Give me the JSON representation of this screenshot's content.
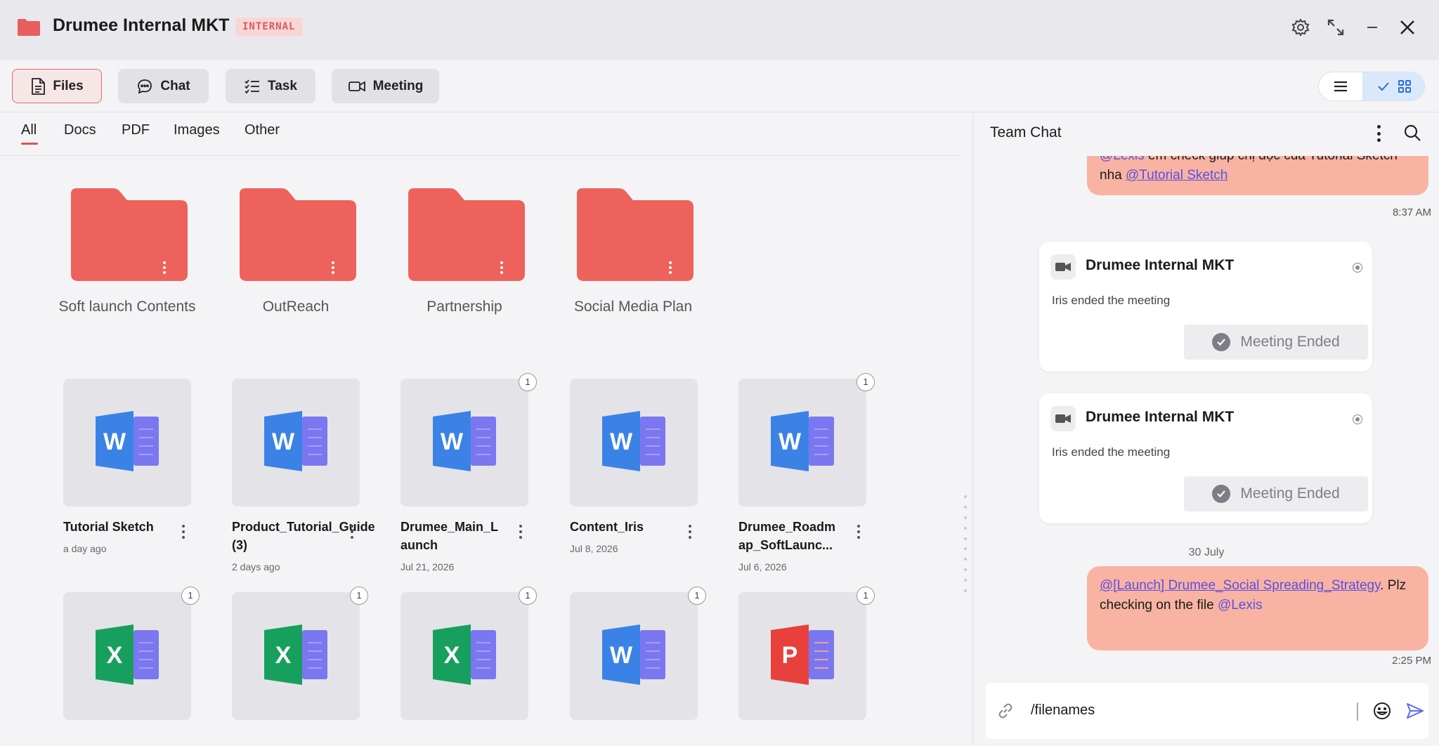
{
  "window": {
    "title": "Drumee Internal MKT",
    "badge": "INTERNAL",
    "folder_icon": "folder-icon",
    "accent_color": "#e85d5d",
    "controls": [
      "gear-icon",
      "expand-icon",
      "minimize-icon",
      "close-icon"
    ]
  },
  "toolbar": {
    "buttons": [
      {
        "label": "Files",
        "icon": "file-icon",
        "active": true
      },
      {
        "label": "Chat",
        "icon": "chat-bubble-icon",
        "active": false
      },
      {
        "label": "Task",
        "icon": "checklist-icon",
        "active": false
      },
      {
        "label": "Meeting",
        "icon": "video-camera-icon",
        "active": false
      }
    ],
    "view_modes": [
      {
        "icon": "list-view-icon",
        "selected": false
      },
      {
        "icon": "grid-view-icon",
        "selected": true
      }
    ]
  },
  "file_filters": {
    "tabs": [
      "All",
      "Docs",
      "PDF",
      "Images",
      "Other"
    ],
    "active": "All"
  },
  "folders": [
    {
      "label": "Soft launch Contents"
    },
    {
      "label": "OutReach"
    },
    {
      "label": "Partnership"
    },
    {
      "label": "Social Media Plan"
    }
  ],
  "files": [
    {
      "name": "Tutorial Sketch",
      "date": "a day ago",
      "type": "word",
      "badge": ""
    },
    {
      "name": "Product_Tutorial_Guide (3)",
      "date": "2 days ago",
      "type": "word",
      "badge": ""
    },
    {
      "name": "Drumee_Main_Launch",
      "date": "Jul 21, 2026",
      "type": "word",
      "badge": "1"
    },
    {
      "name": "Content_Iris",
      "date": "Jul 8, 2026",
      "type": "word",
      "badge": ""
    },
    {
      "name": "Drumee_Roadmap_SoftLaunc...",
      "date": "Jul 6, 2026",
      "type": "word",
      "badge": "1"
    },
    {
      "name": "",
      "date": "",
      "type": "excel",
      "badge": "1"
    },
    {
      "name": "",
      "date": "",
      "type": "excel",
      "badge": "1"
    },
    {
      "name": "",
      "date": "",
      "type": "excel",
      "badge": "1"
    },
    {
      "name": "",
      "date": "",
      "type": "word",
      "badge": "1"
    },
    {
      "name": "",
      "date": "",
      "type": "powerpoint",
      "badge": "1"
    }
  ],
  "chat": {
    "title": "Team Chat",
    "first_message": {
      "mention1": "@Lexis",
      "text1": " em check giúp chị đọc của Tutorial Sketch nha ",
      "mention2": "@Tutorial Sketch",
      "time": "8:37 AM"
    },
    "meeting_cards": [
      {
        "title": "Drumee Internal MKT",
        "text": "Iris ended the meeting",
        "button": "Meeting Ended"
      },
      {
        "title": "Drumee Internal MKT",
        "text": "Iris ended the meeting",
        "button": "Meeting Ended"
      }
    ],
    "date_separator": "30 July",
    "last_message": {
      "mention1": "@[Launch] Drumee_Social Spreading_Strategy",
      "text1": ". Plz checking on the file ",
      "mention2": "@Lexis",
      "time": "2:25 PM"
    },
    "composer": {
      "value": "/filenames",
      "placeholder": "",
      "icons": [
        "link-icon",
        "emoji-icon",
        "send-icon"
      ]
    }
  }
}
